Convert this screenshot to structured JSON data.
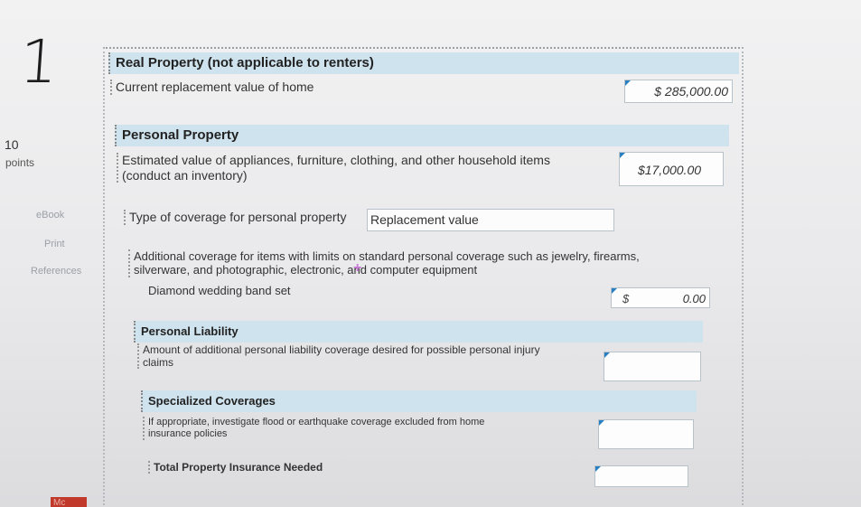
{
  "question_number": "1",
  "points": {
    "value": "10",
    "label": "points"
  },
  "sidebar": {
    "ebook": "eBook",
    "print": "Print",
    "references": "References"
  },
  "badge": "Mc",
  "real_property": {
    "heading": "Real Property (not applicable to renters)",
    "label": "Current replacement value of home",
    "amount": "$ 285,000.00"
  },
  "personal_property": {
    "heading": "Personal Property",
    "label_line1": "Estimated value of appliances, furniture, clothing, and other household items",
    "label_line2": "(conduct an inventory)",
    "amount": "$17,000.00"
  },
  "coverage_type": {
    "label": "Type of coverage for personal property",
    "selected": "Replacement value"
  },
  "additional_coverage": {
    "line1": "Additional coverage for items with limits on standard personal coverage such as jewelry, firearms,",
    "line2": "silverware, and photographic, electronic, and computer equipment",
    "item_label": "Diamond wedding band set",
    "currency": "$",
    "amount": "0.00"
  },
  "personal_liability": {
    "heading": "Personal Liability",
    "label_line1": "Amount of additional personal liability coverage desired for possible personal injury",
    "label_line2": "claims",
    "amount": ""
  },
  "specialized": {
    "heading": "Specialized Coverages",
    "label_line1": "If appropriate, investigate flood or earthquake coverage excluded from home",
    "label_line2": "insurance policies",
    "amount": ""
  },
  "total": {
    "label": "Total Property Insurance Needed",
    "amount": ""
  }
}
